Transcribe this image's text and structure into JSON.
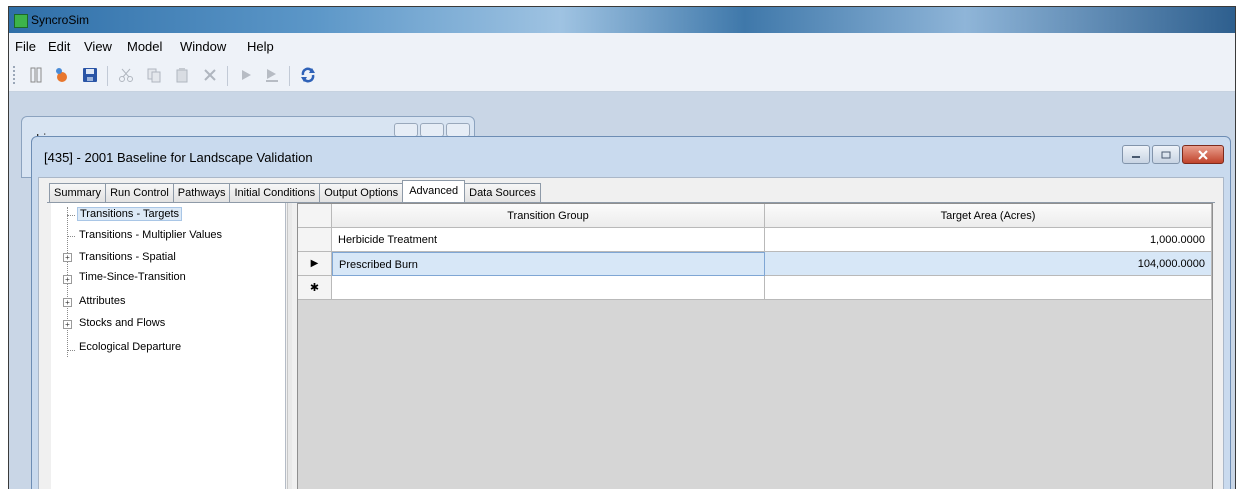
{
  "app": {
    "title": "SyncroSim"
  },
  "menu": [
    "File",
    "Edit",
    "View",
    "Model",
    "Window",
    "Help"
  ],
  "toolbar": {
    "buttons": [
      "library-icon",
      "open-icon",
      "save-icon",
      "cut-icon",
      "copy-icon",
      "paste-icon",
      "delete-icon",
      "run-icon",
      "run-step-icon",
      "refresh-icon"
    ]
  },
  "background_window": {
    "label": "Li"
  },
  "scenario_window": {
    "title": "[435] - 2001 Baseline for Landscape Validation",
    "tabs": [
      "Summary",
      "Run Control",
      "Pathways",
      "Initial Conditions",
      "Output Options",
      "Advanced",
      "Data Sources"
    ],
    "active_tab": "Advanced"
  },
  "tree": [
    {
      "label": "Transitions - Targets",
      "selected": true,
      "expandable": false
    },
    {
      "label": "Transitions - Multiplier Values",
      "selected": false,
      "expandable": false
    },
    {
      "label": "Transitions - Spatial",
      "selected": false,
      "expandable": true
    },
    {
      "label": "Time-Since-Transition",
      "selected": false,
      "expandable": true
    },
    {
      "label": "Attributes",
      "selected": false,
      "expandable": true
    },
    {
      "label": "Stocks and Flows",
      "selected": false,
      "expandable": true
    },
    {
      "label": "Ecological Departure",
      "selected": false,
      "expandable": false
    }
  ],
  "grid": {
    "columns": [
      "Transition Group",
      "Target Area (Acres)"
    ],
    "rows": [
      {
        "indicator": "",
        "group": "Herbicide Treatment",
        "area": "1,000.0000"
      },
      {
        "indicator": "▶",
        "group": "Prescribed Burn",
        "area": "104,000.0000"
      },
      {
        "indicator": "✱",
        "group": "",
        "area": ""
      }
    ]
  },
  "colors": {
    "titlebar": "#2f6fa8",
    "selection": "#d7e7f7",
    "close_button": "#c0432b"
  }
}
